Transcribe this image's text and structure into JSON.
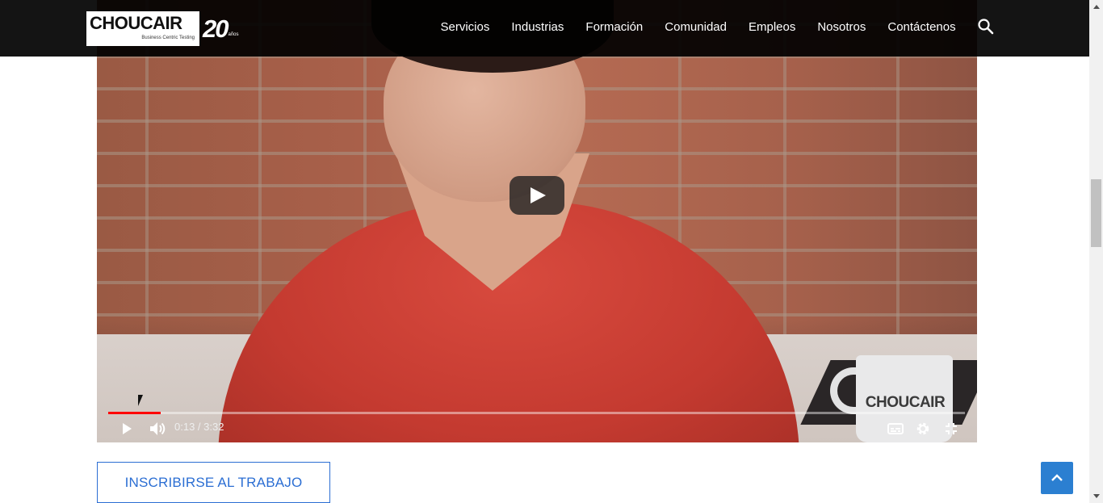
{
  "header": {
    "logo_text": "CHOUCAIR",
    "logo_tagline": "Business Centric Testing",
    "logo_anniversary": "20",
    "logo_years": "años",
    "nav": [
      {
        "label": "Servicios"
      },
      {
        "label": "Industrias"
      },
      {
        "label": "Formación"
      },
      {
        "label": "Comunidad"
      },
      {
        "label": "Empleos"
      },
      {
        "label": "Nosotros"
      },
      {
        "label": "Contáctenos"
      }
    ],
    "search_icon": "search-icon"
  },
  "video": {
    "current_time": "0:13",
    "duration": "3:32",
    "time_display": "0:13 / 3:32",
    "progress_fraction": 0.061,
    "mug_text": "CHOUCAIR",
    "icons": [
      "play-icon",
      "volume-icon",
      "subtitles-icon",
      "settings-icon",
      "exit-fullscreen-icon",
      "big-play-icon"
    ]
  },
  "cta": {
    "label": "INSCRIBIRSE AL TRABAJO"
  },
  "colors": {
    "accent": "#2b6ed3",
    "header_bg": "#000000",
    "progress": "#ff0000"
  }
}
